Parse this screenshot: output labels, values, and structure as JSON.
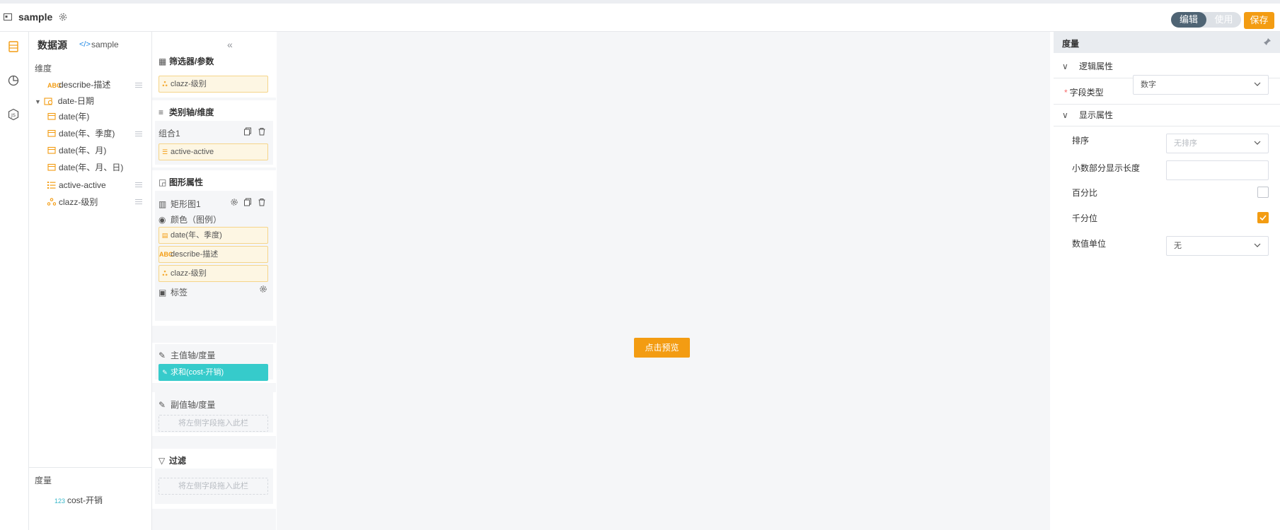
{
  "header": {
    "title": "sample",
    "mode_edit": "编辑",
    "mode_use": "使用",
    "save_label": "保存"
  },
  "colors": {
    "accent": "#f39c12",
    "teal": "#36cbcb",
    "toggle_active": "#4f6474"
  },
  "rail": {
    "icons": [
      "dataset-icon",
      "chart-icon",
      "js-icon"
    ]
  },
  "datasource": {
    "title": "数据源",
    "code_icon": "</>",
    "name": "sample",
    "collapse_icon": "«",
    "dimension_label": "维度",
    "dimensions": [
      {
        "label": "describe-描述",
        "icon": "ABC"
      },
      {
        "label": "date-日期",
        "icon": "calendar-group-icon"
      },
      {
        "label": "date(年)",
        "icon": "calendar-icon"
      },
      {
        "label": "date(年、季度)",
        "icon": "calendar-icon"
      },
      {
        "label": "date(年、月)",
        "icon": "calendar-icon"
      },
      {
        "label": "date(年、月、日)",
        "icon": "calendar-icon"
      },
      {
        "label": "active-active",
        "icon": "list-icon"
      },
      {
        "label": "clazz-级别",
        "icon": "hierarchy-icon"
      }
    ],
    "measure_label": "度量",
    "measures": [
      {
        "label": "cost-开销",
        "icon": "123"
      }
    ]
  },
  "config": {
    "filter_params": {
      "title": "筛选器/参数",
      "fields": [
        "clazz-级别"
      ]
    },
    "category_axis": {
      "title": "类别轴/维度",
      "group": "组合1",
      "fields": [
        "active-active"
      ]
    },
    "graph_props": {
      "title": "图形属性",
      "chart_name": "矩形图1",
      "color_label": "颜色（图例）",
      "color_fields": [
        {
          "label": "date(年、季度)",
          "icon": "calendar-icon"
        },
        {
          "label": "describe-描述",
          "icon": "ABC"
        },
        {
          "label": "clazz-级别",
          "icon": "hierarchy-icon"
        }
      ],
      "tag_label": "标签"
    },
    "main_axis": {
      "title": "主值轴/度量",
      "fields": [
        "求和(cost-开销)"
      ]
    },
    "sub_axis": {
      "title": "副值轴/度量",
      "drop_hint": "将左侧字段拖入此栏"
    },
    "filter": {
      "title": "过滤",
      "drop_hint": "将左侧字段拖入此栏"
    }
  },
  "canvas": {
    "preview_label": "点击预览"
  },
  "properties": {
    "title": "度量",
    "logic_section": "逻辑属性",
    "field_type_label": "字段类型",
    "field_type_value": "数字",
    "display_section": "显示属性",
    "sort_label": "排序",
    "sort_placeholder": "无排序",
    "decimal_label": "小数部分显示长度",
    "decimal_value": "",
    "percent_label": "百分比",
    "percent_checked": false,
    "thousands_label": "千分位",
    "thousands_checked": true,
    "unit_label": "数值单位",
    "unit_value": "无"
  }
}
